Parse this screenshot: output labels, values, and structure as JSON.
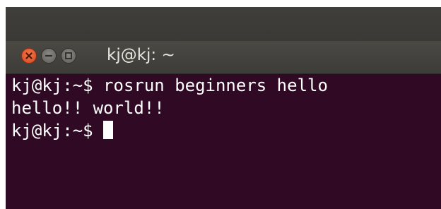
{
  "window": {
    "title": "kj@kj: ~"
  },
  "terminal": {
    "lines": [
      "kj@kj:~$ rosrun beginners hello",
      "hello!! world!!"
    ],
    "prompt": "kj@kj:~$"
  },
  "icons": {
    "close": "close-icon",
    "minimize": "minimize-icon",
    "maximize": "maximize-icon"
  },
  "colors": {
    "terminal_bg": "#300a24",
    "close_button": "#e95420",
    "text": "#ffffff"
  }
}
